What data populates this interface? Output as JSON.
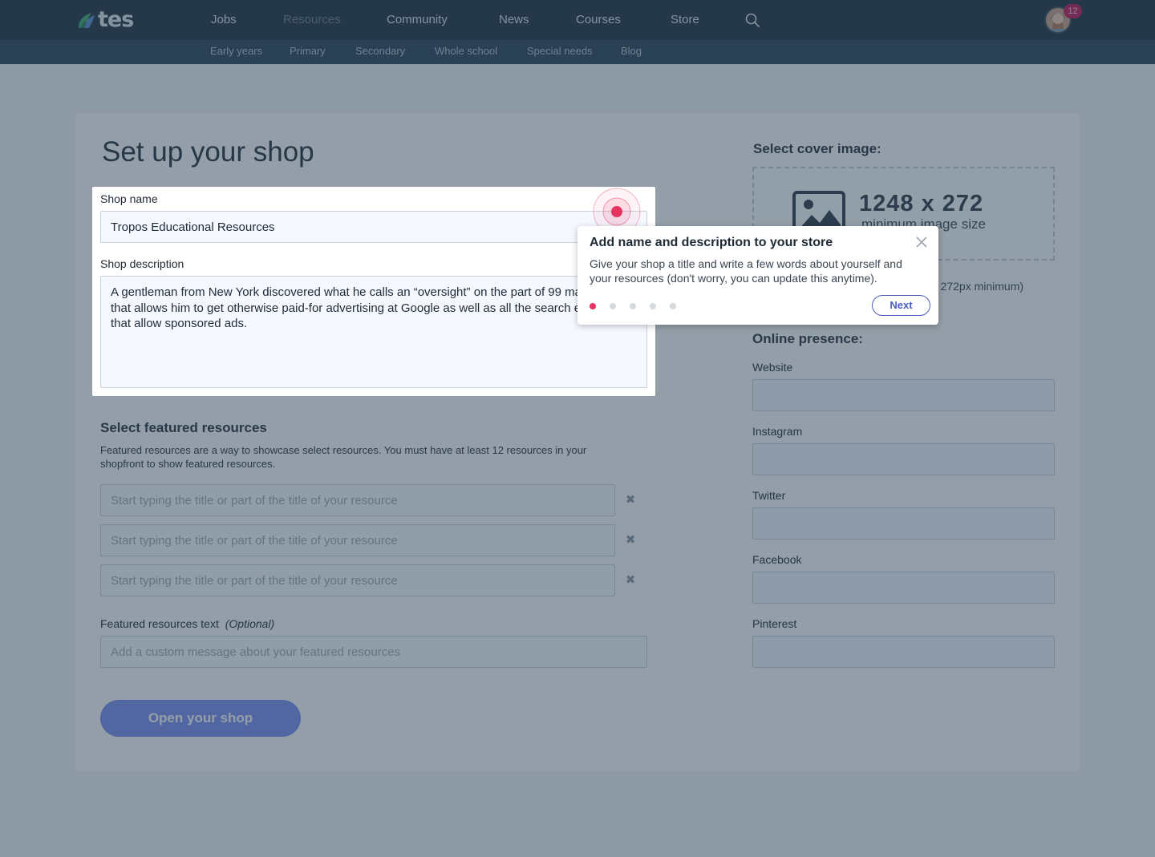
{
  "nav": {
    "logo_text": "tes",
    "main_links": [
      "Jobs",
      "Resources",
      "Community",
      "News",
      "Courses",
      "Store"
    ],
    "active_link": "Resources",
    "notification_count": "12",
    "sub_links": [
      "Early years",
      "Primary",
      "Secondary",
      "Whole school",
      "Special needs",
      "Blog"
    ]
  },
  "page": {
    "title": "Set up your shop"
  },
  "shop_form": {
    "name_label": "Shop name",
    "name_value": "Tropos Educational Resources",
    "description_label": "Shop description",
    "description_value": "A gentleman from New York discovered what he calls an “oversight” on the part of 99 marketers that allows him to get otherwise paid-for advertising at Google as well as all the search engines that allow sponsored ads."
  },
  "featured": {
    "heading": "Select featured resources",
    "description": "Featured resources are a way to showcase select resources. You must have at least 12 resources in your shopfront to show featured resources.",
    "search_placeholder": "Start typing the title or part of the title of your resource",
    "remove_symbol": "✖",
    "text_label": "Featured resources text",
    "text_optional": "(Optional)",
    "text_placeholder": "Add a custom message about your featured resources"
  },
  "submit": {
    "label": "Open your shop"
  },
  "cover": {
    "heading": "Select cover image:",
    "size": "1248 x 272",
    "size_caption": "minimum image size",
    "hint": "3 x 272px minimum)"
  },
  "online": {
    "heading": "Online presence:",
    "fields": [
      "Website",
      "Instagram",
      "Twitter",
      "Facebook",
      "Pinterest"
    ]
  },
  "tour": {
    "title": "Add name and description to your store",
    "body": "Give your shop a title and write a few words about yourself and your resources (don't worry, you can update this anytime).",
    "step_current": 1,
    "step_total": 5,
    "next_label": "Next"
  },
  "colors": {
    "nav_bg": "#203240",
    "subnav_bg": "#2c4558",
    "accent_pink": "#e6335f",
    "brand_blue": "#4a5fc1",
    "button_blue": "#7d8ff0"
  }
}
